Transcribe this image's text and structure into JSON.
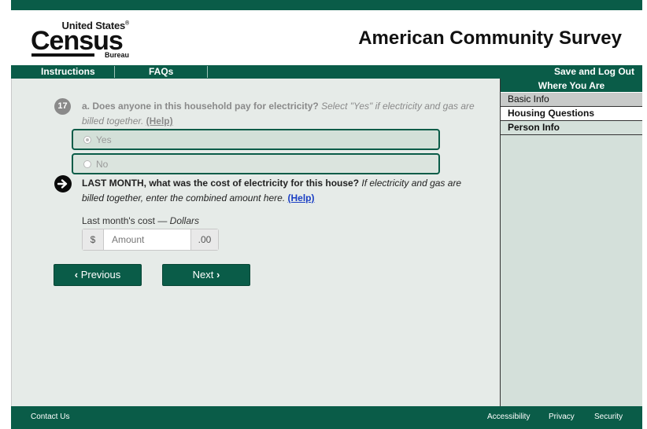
{
  "header": {
    "logo_line1": "United States",
    "logo_registered": "®",
    "logo_main": "Census",
    "logo_bureau": "Bureau",
    "title": "American Community Survey"
  },
  "nav": {
    "instructions": "Instructions",
    "faqs": "FAQs",
    "save_logout": "Save and Log Out"
  },
  "sidebar": {
    "heading": "Where You Are",
    "items": [
      "Basic Info",
      "Housing Questions",
      "Person Info"
    ]
  },
  "question17": {
    "number": "17",
    "text_bold": "a. Does anyone in this household pay for electricity?",
    "text_italic": " Select \"Yes\" if electricity and gas are billed together.",
    "help": "(Help)",
    "options": [
      "Yes",
      "No"
    ],
    "selected": "Yes"
  },
  "question17b": {
    "text_bold": "LAST MONTH, what was the cost of electricity for this house?",
    "text_italic": " If electricity and gas are billed together, enter the combined amount here.",
    "help": "(Help)",
    "amount_label": "Last month's cost — ",
    "amount_label_italic": "Dollars",
    "currency": "$",
    "amount_placeholder": "Amount",
    "cents": ".00"
  },
  "buttons": {
    "previous": "Previous",
    "next": "Next",
    "prev_icon": "‹",
    "next_icon": "›"
  },
  "footer": {
    "contact": "Contact Us",
    "accessibility": "Accessibility",
    "privacy": "Privacy",
    "security": "Security"
  },
  "colors": {
    "brand_green": "#0a5c48",
    "page_background": "#e6ebe8",
    "link_blue": "#1b3fc4"
  }
}
